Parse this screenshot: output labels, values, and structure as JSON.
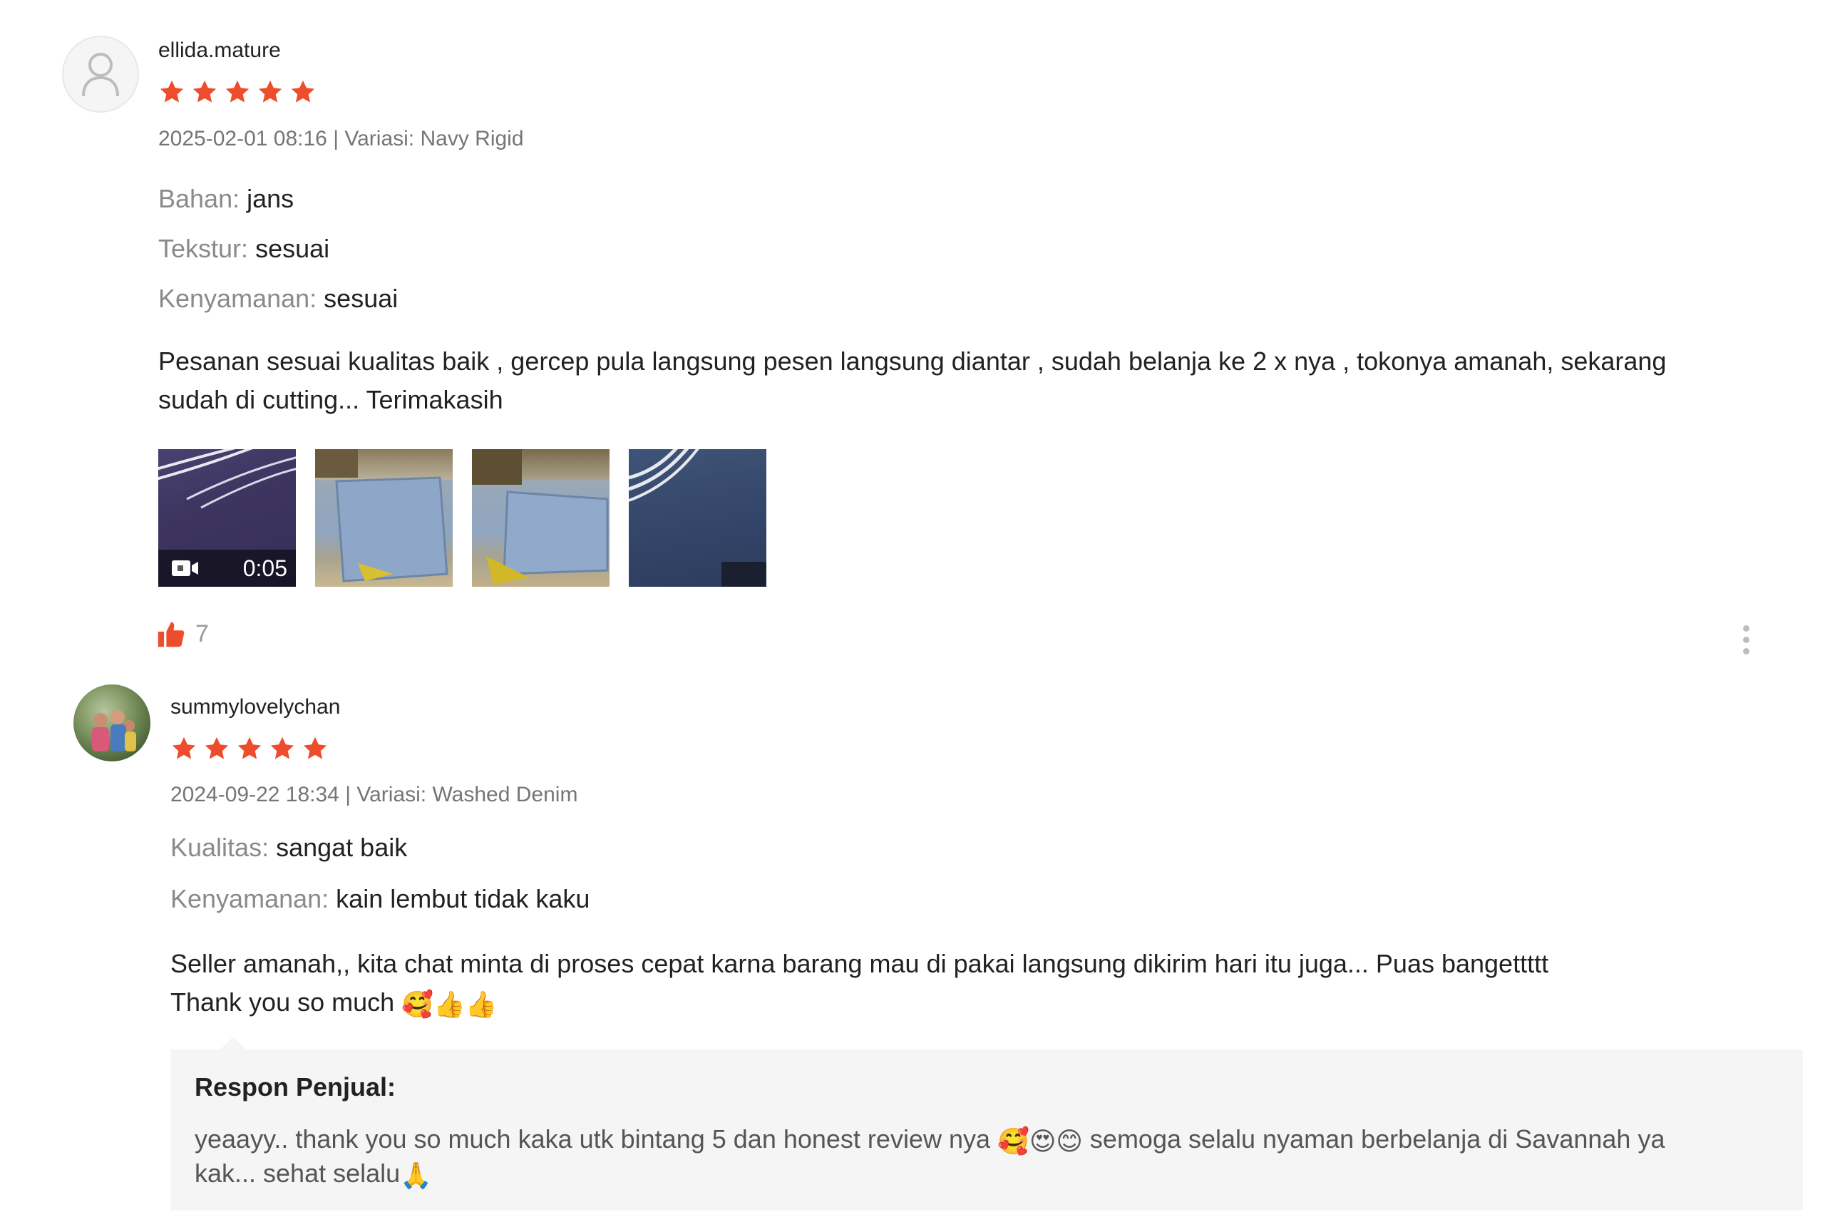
{
  "reviews": [
    {
      "username": "ellida.mature",
      "rating": 5,
      "meta": "2025-02-01 08:16 | Variasi: Navy Rigid",
      "attributes": [
        {
          "key": "Bahan:",
          "value": "jans"
        },
        {
          "key": "Tekstur:",
          "value": "sesuai"
        },
        {
          "key": "Kenyamanan:",
          "value": "sesuai"
        }
      ],
      "comment_line1": "Pesanan sesuai kualitas baik , gercep pula langsung pesen langsung diantar , sudah belanja ke 2 x nya , tokonya amanah, sekarang",
      "comment_line2": "sudah di cutting... Terimakasih",
      "media": {
        "video_duration": "0:05",
        "thumbnails": [
          "video-thumbnail",
          "photo-1",
          "photo-2",
          "photo-3"
        ]
      },
      "likes": "7",
      "accent_color": "#ee4d2d"
    },
    {
      "username": "summylovelychan",
      "rating": 5,
      "meta": "2024-09-22 18:34 | Variasi: Washed Denim",
      "attributes": [
        {
          "key": "Kualitas:",
          "value": "sangat baik"
        },
        {
          "key": "Kenyamanan:",
          "value": "kain lembut tidak kaku"
        }
      ],
      "comment_line1": "Seller amanah,, kita chat minta di proses cepat karna barang mau di pakai langsung dikirim hari itu juga... Puas bangettttt",
      "comment_line2": "Thank you so much",
      "comment_emojis": "🥰👍👍",
      "seller_response": {
        "title": "Respon Penjual:",
        "line1": "yeaayy.. thank you so much kaka utk bintang 5 dan honest review nya",
        "line1_emojis": "🥰😍😊",
        "line1_tail": "semoga selalu nyaman berbelanja di Savannah ya",
        "line2": "kak... sehat selalu",
        "line2_emoji": "🙏"
      }
    }
  ]
}
